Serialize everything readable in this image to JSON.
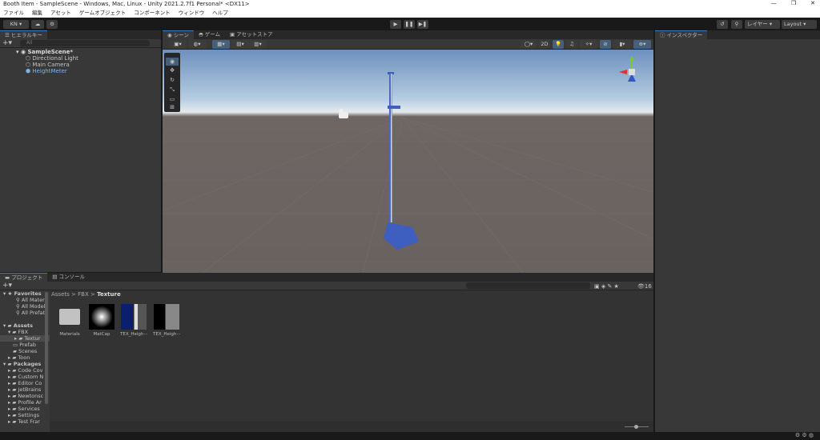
{
  "window": {
    "title": "Booth Item - SampleScene - Windows, Mac, Linux - Unity 2021.2.7f1 Personal* <DX11>",
    "controls": [
      "—",
      "❐",
      "✕"
    ]
  },
  "menu": [
    "ファイル",
    "編集",
    "アセット",
    "ゲームオブジェクト",
    "コンポーネント",
    "ウィンドウ",
    "ヘルプ"
  ],
  "toolbar": {
    "account": "KN ▾",
    "layers": "レイヤー",
    "layout": "Layout"
  },
  "hierarchy": {
    "tab": "ヒエラルキー",
    "search_placeholder": "All",
    "scene": "SampleScene*",
    "items": [
      "Directional Light",
      "Main Camera",
      "HeightMeter"
    ]
  },
  "scene_tabs": [
    "シーン",
    "ゲーム",
    "アセットストア"
  ],
  "scene_toolbar": {
    "mode_2d": "2D"
  },
  "inspector": {
    "tab": "インスペクター"
  },
  "project": {
    "tabs": [
      "プロジェクト",
      "コンソール"
    ],
    "breadcrumb": [
      "Assets",
      "FBX",
      "Texture"
    ],
    "hidden_count": "16",
    "tree": {
      "favorites": "Favorites",
      "fav_items": [
        "All Mater",
        "All Model",
        "All Prefat"
      ],
      "assets": "Assets",
      "fbx": "FBX",
      "texture": "Textur",
      "asset_items": [
        "Prefab",
        "Scenes",
        "Toon"
      ],
      "packages": "Packages",
      "package_items": [
        "Code Cov",
        "Custom N",
        "Editor Co",
        "JetBrains",
        "Newtonsc",
        "Profile Ar",
        "Services",
        "Settings",
        "Test Frar"
      ]
    },
    "assets": [
      "Materials",
      "MatCap",
      "TEX_Heigh···",
      "TEX_Heigh···"
    ]
  },
  "colors": {
    "accent": "#3a79bb",
    "selected_text": "#7fb3ef",
    "meter": "#3e5fbf"
  }
}
